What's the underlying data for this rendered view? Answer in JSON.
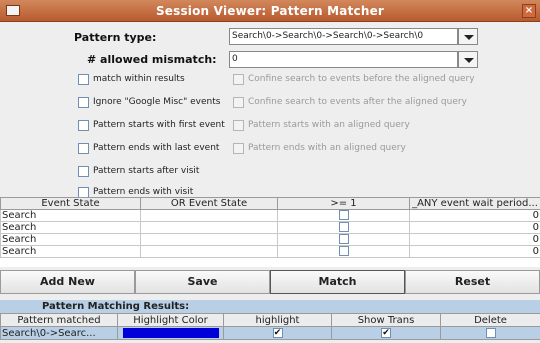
{
  "window": {
    "title": "Session Viewer: Pattern Matcher",
    "close_glyph": "×"
  },
  "form": {
    "pattern_type_label": "Pattern type:",
    "pattern_type_value": "Search\\0->Search\\0->Search\\0->Search\\0",
    "mismatch_label": "# allowed mismatch:",
    "mismatch_value": "0"
  },
  "options_left": [
    {
      "label": "match within results",
      "checked": false
    },
    {
      "label": "Ignore \"Google Misc\" events",
      "checked": false
    },
    {
      "label": "Pattern starts with first event",
      "checked": false
    },
    {
      "label": "Pattern ends with last event",
      "checked": false
    },
    {
      "label": "Pattern starts after visit",
      "checked": false
    },
    {
      "label": "Pattern ends with visit",
      "checked": false
    }
  ],
  "options_right": [
    {
      "label": "Confine search to events before the aligned query",
      "checked": false,
      "enabled": false
    },
    {
      "label": "Confine search to events after the aligned query",
      "checked": false,
      "enabled": false
    },
    {
      "label": "Pattern starts with an aligned query",
      "checked": false,
      "enabled": false
    },
    {
      "label": "Pattern ends with an aligned query",
      "checked": false,
      "enabled": false
    }
  ],
  "pattern_table": {
    "headers": [
      "Event State",
      "OR Event State",
      ">= 1",
      "_ANY event wait period..."
    ],
    "rows": [
      {
        "state": "Search",
        "or_state": "",
        "ge1": false,
        "wait": "0"
      },
      {
        "state": "Search",
        "or_state": "",
        "ge1": false,
        "wait": "0"
      },
      {
        "state": "Search",
        "or_state": "",
        "ge1": false,
        "wait": "0"
      },
      {
        "state": "Search",
        "or_state": "",
        "ge1": false,
        "wait": "0"
      }
    ]
  },
  "buttons": {
    "add_new": "Add New",
    "save": "Save",
    "match": "Match",
    "reset": "Reset"
  },
  "results": {
    "title": "Pattern Matching Results:",
    "headers": [
      "Pattern matched",
      "Highlight Color",
      "highlight",
      "Show Trans",
      "Delete"
    ],
    "rows": [
      {
        "pattern": "Search\\0->Searc...",
        "color": "#0000d8",
        "highlight": true,
        "show_trans": true,
        "delete": false
      }
    ]
  },
  "colors": {
    "title_bar": "#c76e42",
    "results_band": "#b8cfe6",
    "checkbox_border": "#6f8fb3"
  }
}
